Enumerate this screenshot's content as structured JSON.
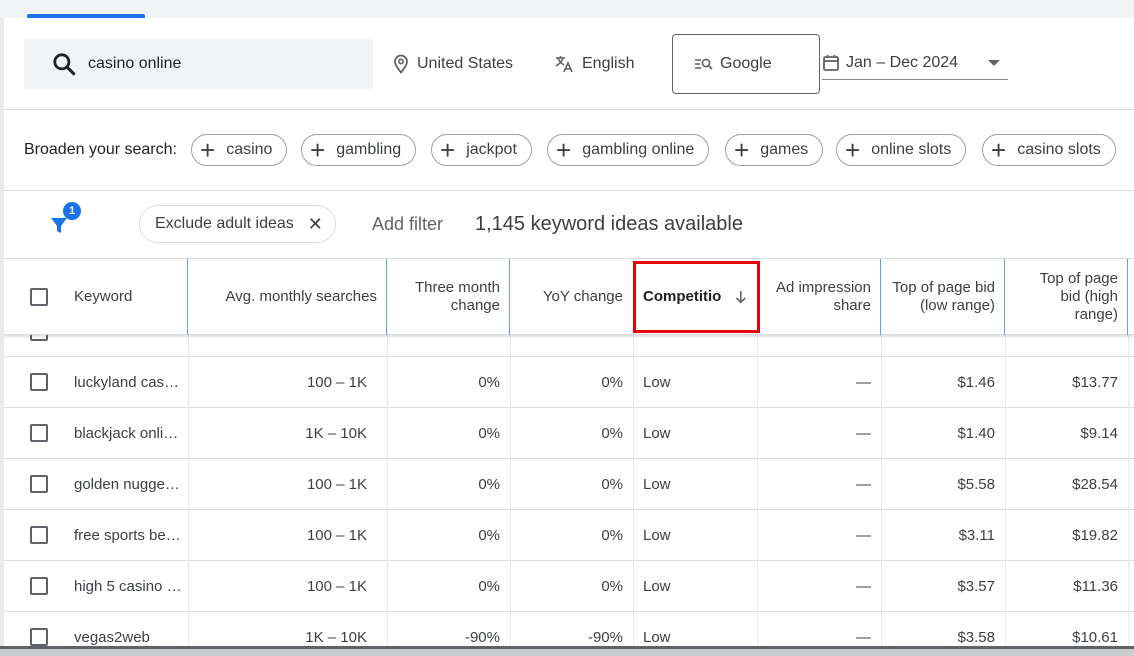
{
  "search": {
    "query": "casino online",
    "location": "United States",
    "language": "English",
    "network": "Google",
    "date_range": "Jan – Dec 2024"
  },
  "broaden": {
    "label": "Broaden your search:",
    "chips": [
      "casino",
      "gambling",
      "jackpot",
      "gambling online",
      "games",
      "online slots",
      "casino slots"
    ]
  },
  "filters": {
    "badge_count": "1",
    "exclude_chip": "Exclude adult ideas",
    "add_filter": "Add filter",
    "ideas_available": "1,145 keyword ideas available"
  },
  "table": {
    "headers": {
      "keyword": "Keyword",
      "avg_monthly": "Avg. monthly searches",
      "three_month": "Three month change",
      "yoy": "YoY change",
      "competition": "Competitio",
      "ad_impression": "Ad impression share",
      "top_low": "Top of page bid (low range)",
      "top_high": "Top of page bid (high range)"
    },
    "rows": [
      {
        "keyword": "luckyland cas…",
        "avg": "100 – 1K",
        "three": "0%",
        "yoy": "0%",
        "comp": "Low",
        "ad": "—",
        "low": "$1.46",
        "high": "$13.77"
      },
      {
        "keyword": "blackjack onli…",
        "avg": "1K – 10K",
        "three": "0%",
        "yoy": "0%",
        "comp": "Low",
        "ad": "—",
        "low": "$1.40",
        "high": "$9.14"
      },
      {
        "keyword": "golden nugge…",
        "avg": "100 – 1K",
        "three": "0%",
        "yoy": "0%",
        "comp": "Low",
        "ad": "—",
        "low": "$5.58",
        "high": "$28.54"
      },
      {
        "keyword": "free sports be…",
        "avg": "100 – 1K",
        "three": "0%",
        "yoy": "0%",
        "comp": "Low",
        "ad": "—",
        "low": "$3.11",
        "high": "$19.82"
      },
      {
        "keyword": "high 5 casino …",
        "avg": "100 – 1K",
        "three": "0%",
        "yoy": "0%",
        "comp": "Low",
        "ad": "—",
        "low": "$3.57",
        "high": "$11.36"
      },
      {
        "keyword": "vegas2web",
        "avg": "1K – 10K",
        "three": "-90%",
        "yoy": "-90%",
        "comp": "Low",
        "ad": "—",
        "low": "$3.58",
        "high": "$10.61"
      }
    ]
  },
  "colors": {
    "accent": "#1a73e8",
    "highlight": "#e8000b"
  }
}
